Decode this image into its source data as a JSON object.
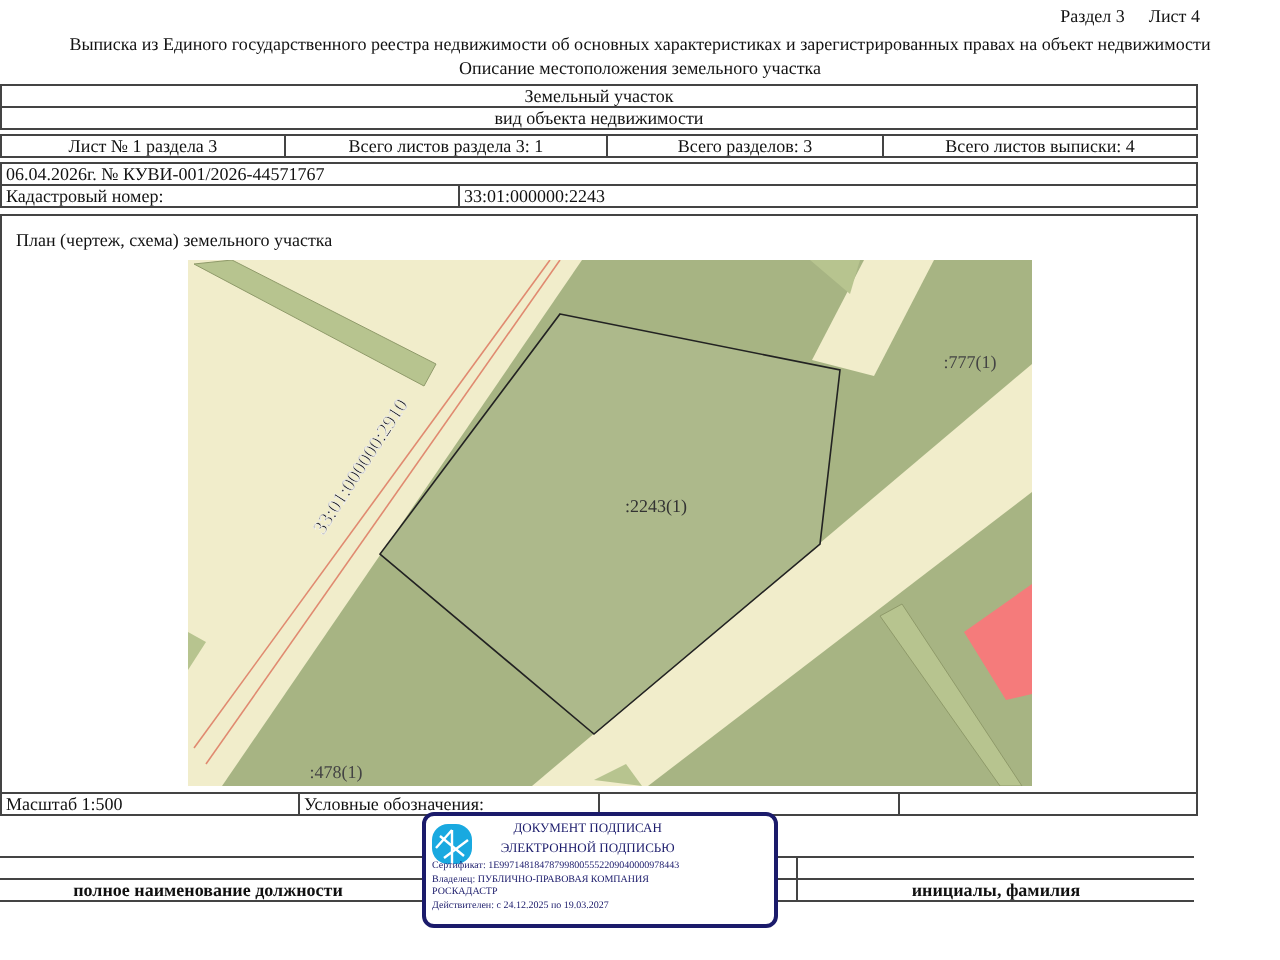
{
  "header": {
    "section": "Раздел 3",
    "sheet": "Лист 4"
  },
  "title": "Выписка из Единого государственного реестра недвижимости об основных характеристиках и зарегистрированных правах на объект недвижимости",
  "subtitle": "Описание местоположения земельного участка",
  "object": {
    "type": "Земельный участок",
    "caption": "вид объекта недвижимости"
  },
  "sheet_info": [
    "Лист № 1 раздела 3",
    "Всего листов раздела 3: 1",
    "Всего разделов: 3",
    "Всего листов выписки: 4"
  ],
  "statement": "06.04.2026г. № КУВИ-001/2026-44571767",
  "cadastral": {
    "label": "Кадастровый номер:",
    "value": "33:01:000000:2243"
  },
  "plan": {
    "title": "План (чертеж, схема) земельного участка",
    "map_labels": [
      {
        "kind": "road",
        "text": "33:01:000000:2910"
      },
      {
        "kind": "parcel",
        "text": ":2243(1)"
      },
      {
        "kind": "neighbor",
        "text": ":777(1)"
      },
      {
        "kind": "neighbor",
        "text": ":478(1)"
      }
    ]
  },
  "footer": {
    "scale": "Масштаб 1:500",
    "legend": "Условные обозначения:"
  },
  "signature": {
    "position_caption": "полное наименование должности",
    "name_caption": "инициалы, фамилия"
  },
  "stamp": {
    "lines": [
      {
        "kind": "heading",
        "text": "ДОКУМЕНТ ПОДПИСАН"
      },
      {
        "kind": "heading",
        "text": "ЭЛЕКТРОННОЙ ПОДПИСЬЮ"
      },
      {
        "kind": "detail",
        "text": "Сертификат: 1E997148184787998005552209040000978443"
      },
      {
        "kind": "detail",
        "text": "Владелец: ПУБЛИЧНО-ПРАВОВАЯ КОМПАНИЯ"
      },
      {
        "kind": "detail",
        "text": "РОСКАДАСТР"
      },
      {
        "kind": "detail",
        "text": "Действителен: с 24.12.2025 по 19.03.2027"
      }
    ]
  }
}
